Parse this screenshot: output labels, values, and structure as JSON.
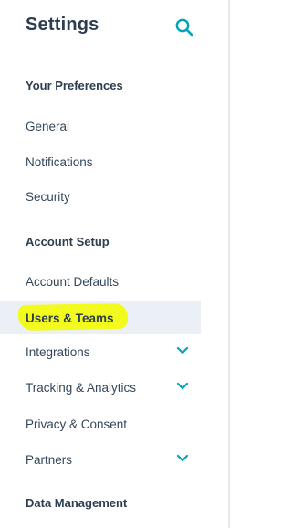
{
  "header": {
    "title": "Settings",
    "search_icon": "search-icon"
  },
  "sections": {
    "preferences": {
      "heading": "Your Preferences",
      "items": [
        "General",
        "Notifications",
        "Security"
      ]
    },
    "account_setup": {
      "heading": "Account Setup",
      "items": [
        "Account Defaults",
        "Users & Teams",
        "Integrations",
        "Tracking & Analytics",
        "Privacy & Consent",
        "Partners"
      ]
    },
    "data_management": {
      "heading": "Data Management"
    }
  },
  "active_item": "Users & Teams",
  "colors": {
    "accent": "#00a4bd",
    "highlight": "#f2fb1d",
    "active_bg": "#eaf0f6",
    "text": "#33475b"
  }
}
